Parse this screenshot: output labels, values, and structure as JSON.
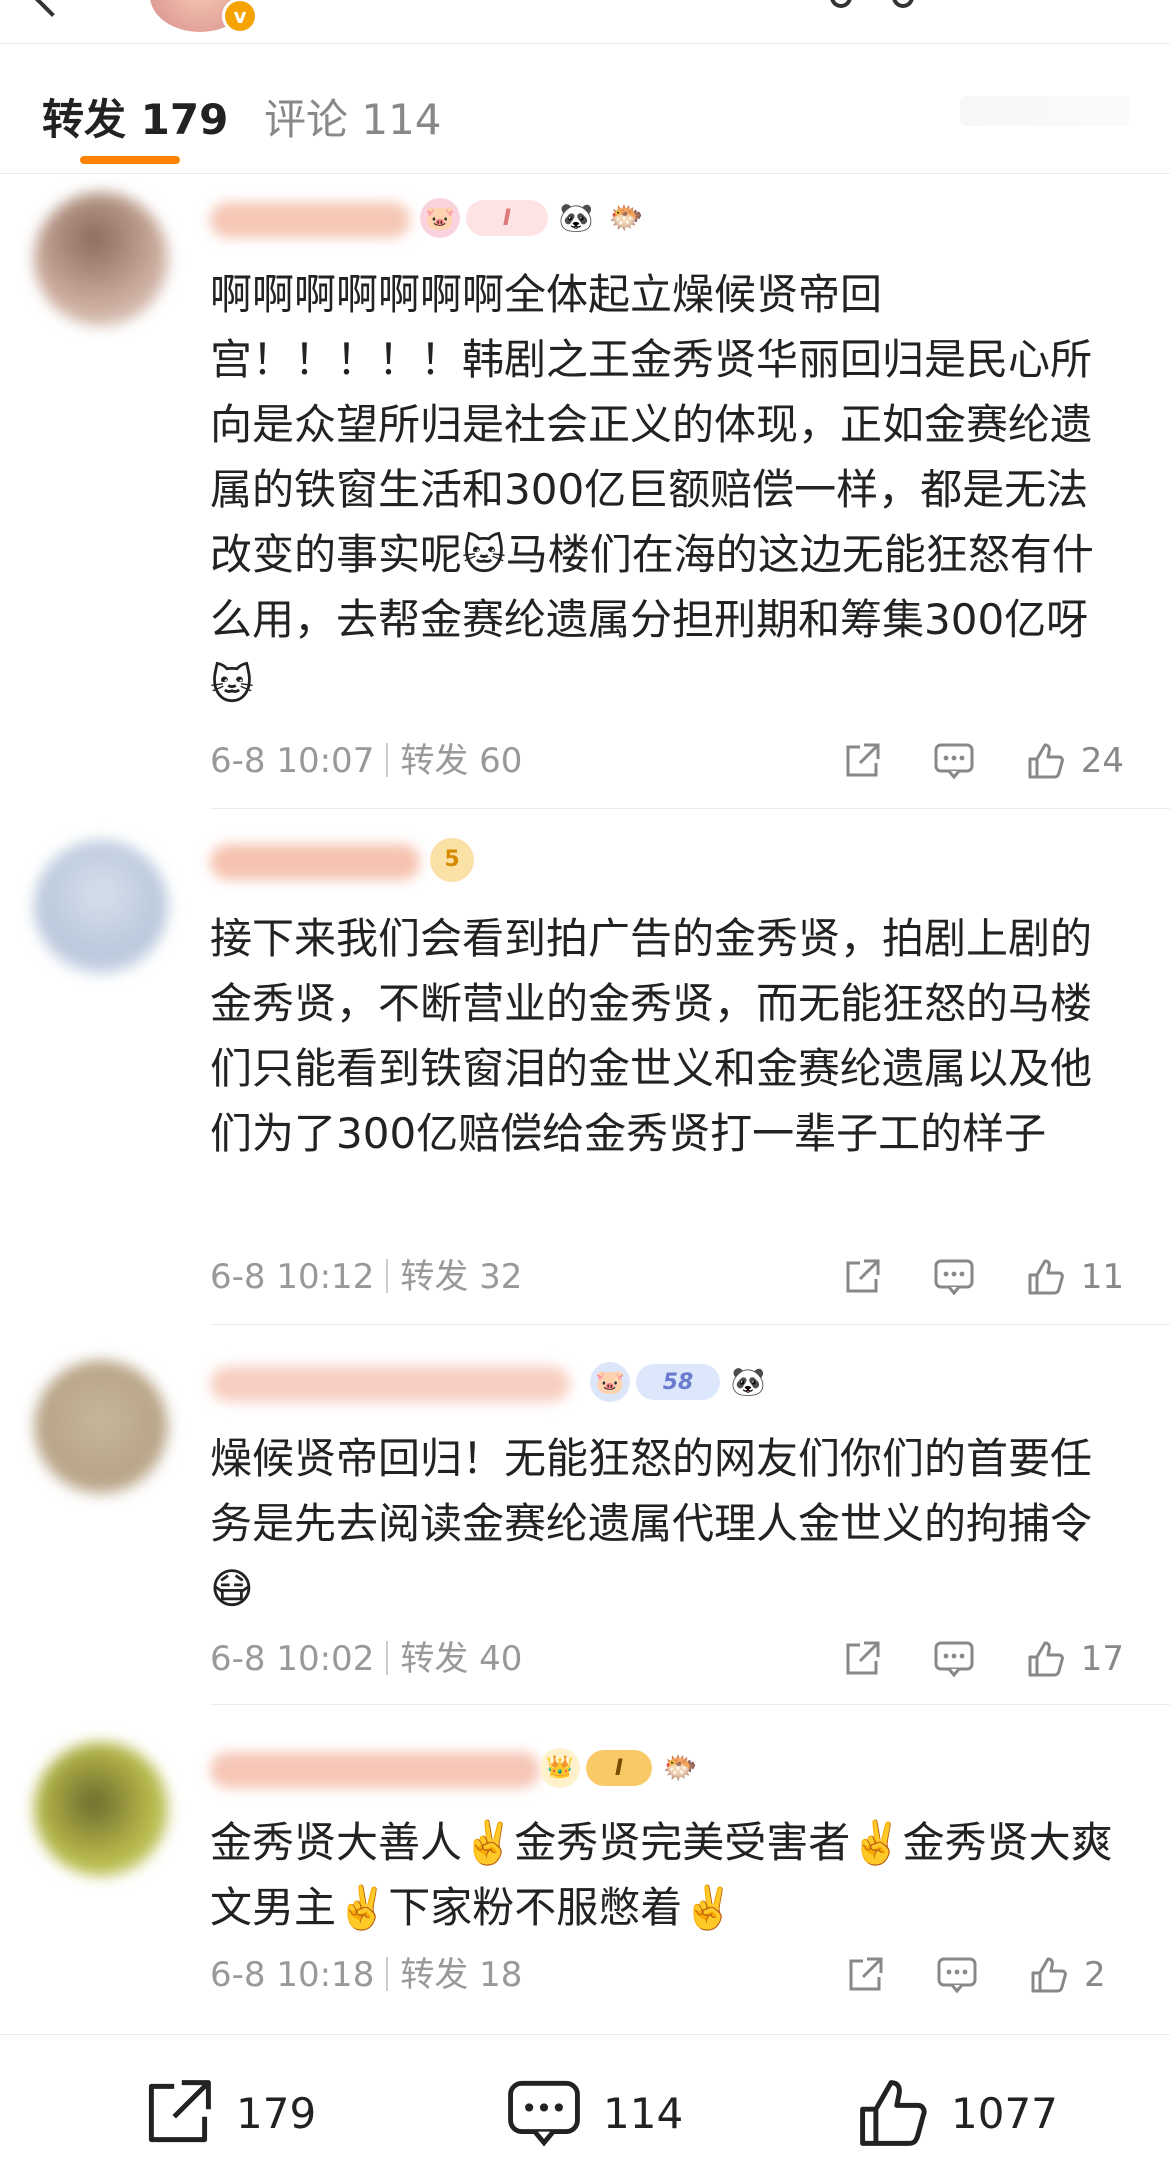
{
  "tabs": {
    "repost_label": "转发 179",
    "comment_label": "评论 114"
  },
  "comments": [
    {
      "text": "啊啊啊啊啊啊啊全体起立燥候贤帝回宫！！！！！韩剧之王金秀贤华丽回归是民心所向是众望所归是社会正义的体现，正如金赛纶遗属的铁窗生活和300亿巨额赔偿一样，都是无法改变的事实呢🐱马楼们在海的这边无能狂怒有什么用，去帮金赛纶遗属分担刑期和筹集300亿呀🐱",
      "time": "6-8 10:07",
      "repost": "转发 60",
      "likes": "24"
    },
    {
      "text": "接下来我们会看到拍广告的金秀贤，拍剧上剧的金秀贤，不断营业的金秀贤，而无能狂怒的马楼们只能看到铁窗泪的金世义和金赛纶遗属以及他们为了300亿赔偿给金秀贤打一辈子工的样子",
      "time": "6-8 10:12",
      "repost": "转发 32",
      "likes": "11"
    },
    {
      "text": "燥候贤帝回归！无能狂怒的网友们你们的首要任务是先去阅读金赛纶遗属代理人金世义的拘捕令 😷",
      "time": "6-8 10:02",
      "repost": "转发 40",
      "likes": "17"
    },
    {
      "text": "金秀贤大善人✌️金秀贤完美受害者✌️金秀贤大爽文男主✌️下家粉不服憋着✌️",
      "time": "6-8 10:18",
      "repost": "转发 18",
      "likes": "2"
    }
  ],
  "badges": {
    "c1_level": "I",
    "c2_level": "5",
    "c3_level": "58",
    "c4_level": "I"
  },
  "bottom_bar": {
    "repost_count": "179",
    "comment_count": "114",
    "like_count": "1077"
  },
  "colors": {
    "accent": "#ff8200",
    "meta_gray": "#999999"
  }
}
